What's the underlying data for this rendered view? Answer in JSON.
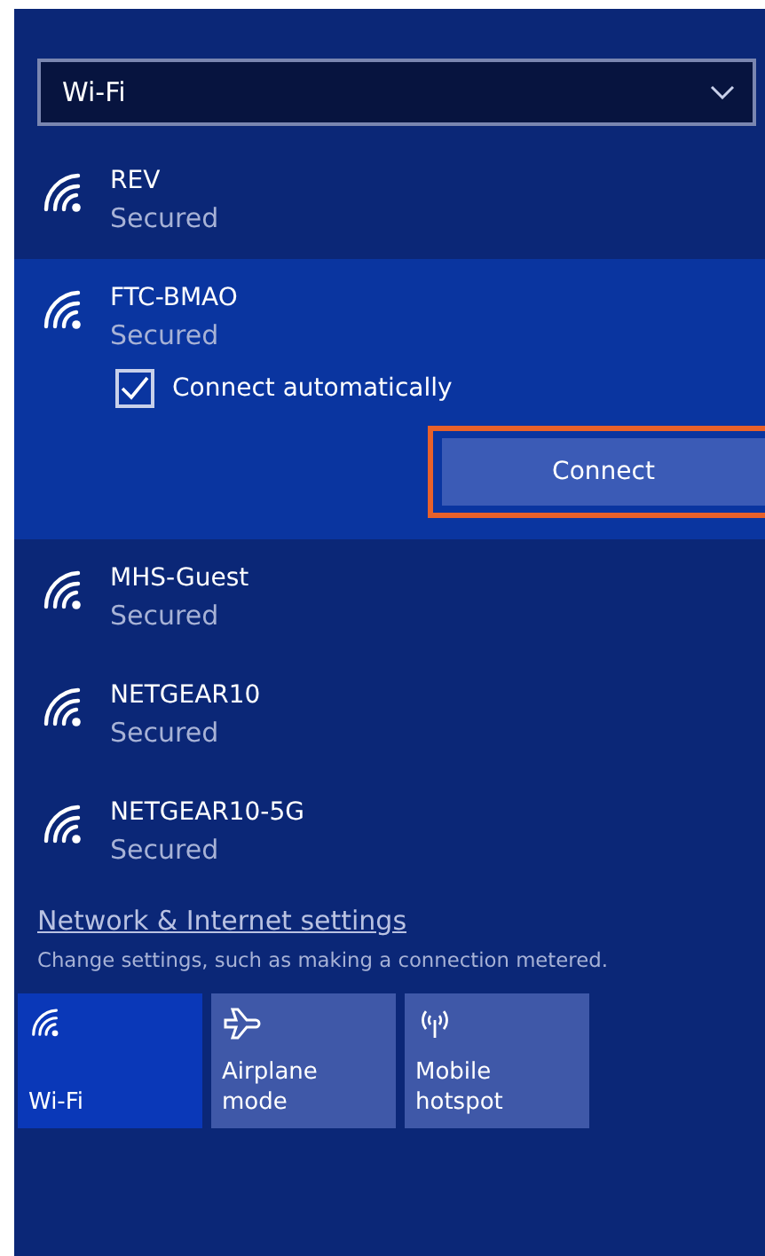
{
  "dropdown": {
    "value": "Wi-Fi"
  },
  "networks": [
    {
      "name": "REV",
      "status": "Secured",
      "selected": false
    },
    {
      "name": "FTC-BMAO",
      "status": "Secured",
      "selected": true,
      "auto_connect": {
        "label": "Connect automatically",
        "checked": true
      },
      "button": "Connect"
    },
    {
      "name": "MHS-Guest",
      "status": "Secured",
      "selected": false
    },
    {
      "name": "NETGEAR10",
      "status": "Secured",
      "selected": false
    },
    {
      "name": "NETGEAR10-5G",
      "status": "Secured",
      "selected": false
    }
  ],
  "settings": {
    "link": "Network & Internet settings",
    "description": "Change settings, such as making a connection metered."
  },
  "tiles": [
    {
      "kind": "wifi",
      "label": "Wi-Fi",
      "on": true
    },
    {
      "kind": "airplane",
      "label": "Airplane mode",
      "on": false
    },
    {
      "kind": "hotspot",
      "label": "Mobile hotspot",
      "on": false
    }
  ]
}
